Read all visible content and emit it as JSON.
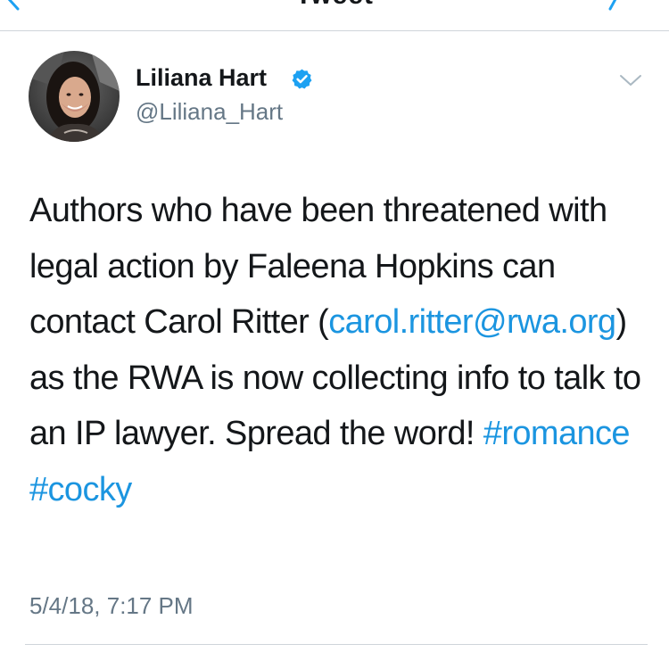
{
  "header": {
    "title": "Tweet"
  },
  "author": {
    "display_name": "Liliana Hart",
    "handle": "@Liliana_Hart",
    "verified": true
  },
  "tweet": {
    "text_part1": "Authors who have been threatened with legal action by Faleena Hopkins can contact Carol Ritter (",
    "email_link": "carol.ritter@rwa.org",
    "text_part2": ") as the RWA is now collecting info to talk to an IP lawyer. Spread the word! ",
    "hashtags": [
      "#romance",
      "#cocky"
    ],
    "timestamp": "5/4/18, 7:17 PM"
  },
  "colors": {
    "link": "#1b95e0",
    "verified": "#1da1f2",
    "secondary_text": "#657786",
    "divider": "#cfd5da"
  },
  "icons": {
    "back": "chevron-left-icon",
    "verified": "verified-badge-icon",
    "more": "chevron-down-icon"
  }
}
